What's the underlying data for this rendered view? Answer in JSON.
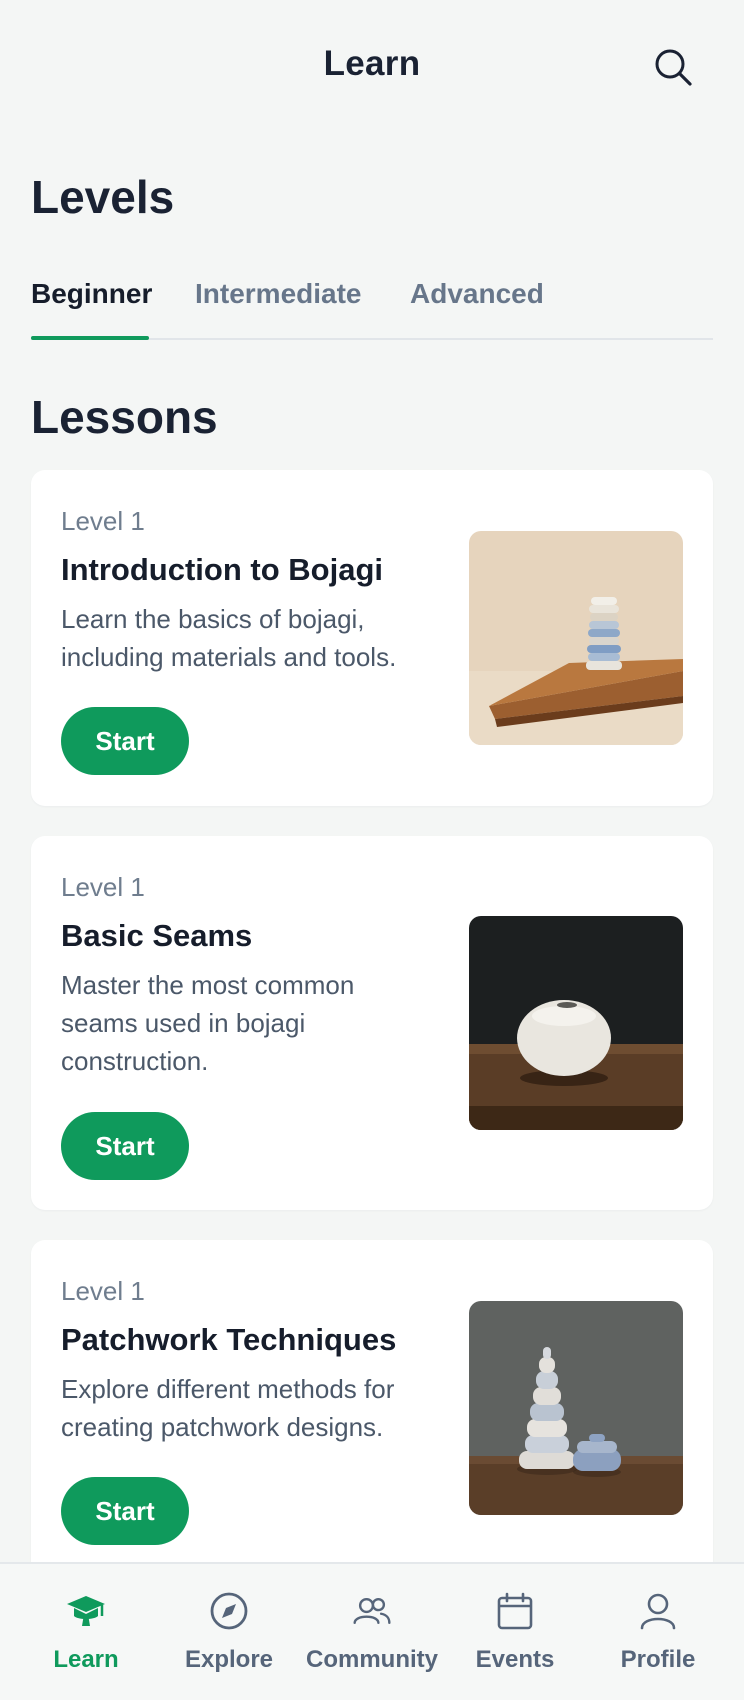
{
  "header": {
    "title": "Learn",
    "search_icon": "search-icon"
  },
  "levels": {
    "heading": "Levels",
    "tabs": [
      {
        "label": "Beginner",
        "active": true
      },
      {
        "label": "Intermediate",
        "active": false
      },
      {
        "label": "Advanced",
        "active": false
      }
    ]
  },
  "lessons": {
    "heading": "Lessons",
    "items": [
      {
        "level": "Level 1",
        "title": "Introduction to Bojagi",
        "description": "Learn the basics of bojagi, including materials and tools.",
        "button": "Start"
      },
      {
        "level": "Level 1",
        "title": "Basic Seams",
        "description": "Master the most common seams used in bojagi construction.",
        "button": "Start"
      },
      {
        "level": "Level 1",
        "title": "Patchwork Techniques",
        "description": "Explore different methods for creating patchwork designs.",
        "button": "Start"
      }
    ]
  },
  "bottom_nav": {
    "items": [
      {
        "label": "Learn",
        "icon": "graduation-cap-icon",
        "active": true
      },
      {
        "label": "Explore",
        "icon": "compass-icon",
        "active": false
      },
      {
        "label": "Community",
        "icon": "users-icon",
        "active": false
      },
      {
        "label": "Events",
        "icon": "calendar-icon",
        "active": false
      },
      {
        "label": "Profile",
        "icon": "user-icon",
        "active": false
      }
    ]
  },
  "colors": {
    "accent": "#0f9a5c",
    "background": "#f4f6f5",
    "text_primary": "#161d2b",
    "text_muted": "#6f7d8e"
  }
}
